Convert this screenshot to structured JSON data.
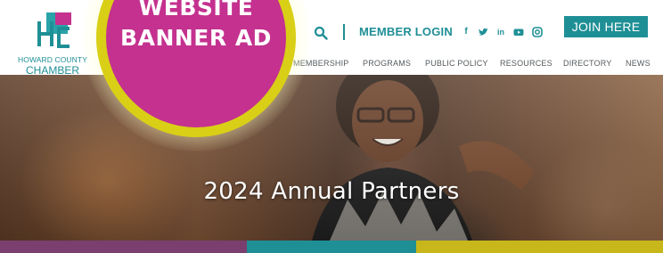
{
  "hero": {
    "title": "2024 Annual Partners"
  },
  "logo": {
    "line1": "HOWARD COUNTY",
    "line2": "CHAMBER"
  },
  "header": {
    "member_login": "MEMBER LOGIN",
    "join_button": "JOIN HERE",
    "social_icons": [
      "facebook-icon",
      "twitter-icon",
      "linkedin-icon",
      "youtube-icon",
      "instagram-icon"
    ]
  },
  "nav": {
    "items": [
      {
        "label": "MEMBERSHIP"
      },
      {
        "label": "PROGRAMS"
      },
      {
        "label": "PUBLIC POLICY"
      },
      {
        "label": "RESOURCES"
      },
      {
        "label": "DIRECTORY"
      },
      {
        "label": "NEWS"
      }
    ]
  },
  "badge": {
    "line1": "WEBSITE",
    "line2": "BANNER AD"
  },
  "colors": {
    "brand_teal": "#1f8f96",
    "badge_magenta": "#c4318f",
    "badge_ring": "#d9cf16",
    "bar_purple": "#7a3f6e",
    "bar_teal": "#1f8f96",
    "bar_yellow": "#c8b71a"
  }
}
